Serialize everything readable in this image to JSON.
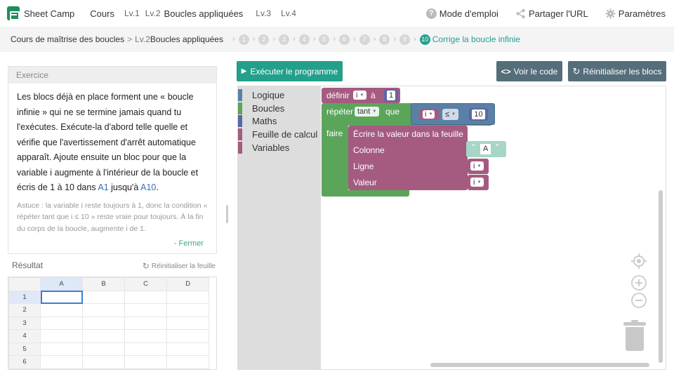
{
  "app": {
    "name": "Sheet Camp",
    "nav": {
      "courses": "Cours",
      "lv1": "Lv.1",
      "lv2": "Lv.2",
      "lv2_title": "Boucles appliquées",
      "lv3": "Lv.3",
      "lv4": "Lv.4"
    },
    "top_links": {
      "manual": "Mode d'emploi",
      "share": "Partager l'URL",
      "settings": "Paramètres"
    }
  },
  "breadcrumb": {
    "course": "Cours de maîtrise des boucles",
    "sep": ">",
    "level": "Lv.2",
    "level_title": "Boucles appliquées",
    "steps": [
      "1",
      "2",
      "3",
      "4",
      "5",
      "6",
      "7",
      "8",
      "9",
      "10"
    ],
    "active_step": "10",
    "active_label": "Corrige la boucle infinie"
  },
  "exercise": {
    "header": "Exercice",
    "text_before_a1": "Les blocs déjà en place forment une « boucle infinie » qui ne se termine jamais quand tu l'exécutes. Exécute-la d'abord telle quelle et vérifie que l'avertissement d'arrêt automatique apparaît. Ajoute ensuite un bloc pour que la variable i augmente à l'intérieur de la boucle et écris de 1 à 10 dans ",
    "a1": "A1",
    "text_middle": " jusqu'à ",
    "a10": "A10",
    "text_end": ".",
    "hint": "Astuce : la variable i reste toujours à 1, donc la condition « répéter tant que i ≤ 10 » reste vraie pour toujours. À la fin du corps de la boucle, augmente i de 1.",
    "close": "- Fermer"
  },
  "result": {
    "header": "Résultat",
    "reset_sheet": "Réinitialiser la feuille",
    "columns": [
      "A",
      "B",
      "C",
      "D"
    ],
    "rows": [
      "1",
      "2",
      "3",
      "4",
      "5",
      "6"
    ],
    "selected_cell": "A1"
  },
  "toolbar": {
    "run": "Exécuter le programme",
    "view_code": "Voir le code",
    "reset_blocks": "Réinitialiser les blocs"
  },
  "toolbox": {
    "categories": [
      {
        "label": "Logique",
        "color": "#5b80a5"
      },
      {
        "label": "Boucles",
        "color": "#5ba55b"
      },
      {
        "label": "Maths",
        "color": "#5b67a5"
      },
      {
        "label": "Feuille de calcul",
        "color": "#a55b80"
      },
      {
        "label": "Variables",
        "color": "#a55b80"
      }
    ]
  },
  "blocks": {
    "set": {
      "label": "définir",
      "var": "i",
      "to": "à",
      "value": "1",
      "color": "#a55b80"
    },
    "repeat": {
      "label": "répéter",
      "mode": "tant",
      "que": "que",
      "do": "faire",
      "color": "#5ba55b"
    },
    "compare": {
      "left": "i",
      "op": "≤",
      "right": "10",
      "color": "#5b80a5",
      "num_color": "#5b67a5"
    },
    "write": {
      "label": "Écrire la valeur dans la feuille",
      "column": "Colonne",
      "row": "Ligne",
      "value": "Valeur",
      "col_value": "A",
      "row_var": "i",
      "value_var": "i",
      "color": "#a55b80",
      "text_color": "#a5d6c8"
    }
  },
  "colors": {
    "accent": "#23a08c",
    "button_gray": "#546e7a",
    "cell_link": "#3b6fb0"
  }
}
